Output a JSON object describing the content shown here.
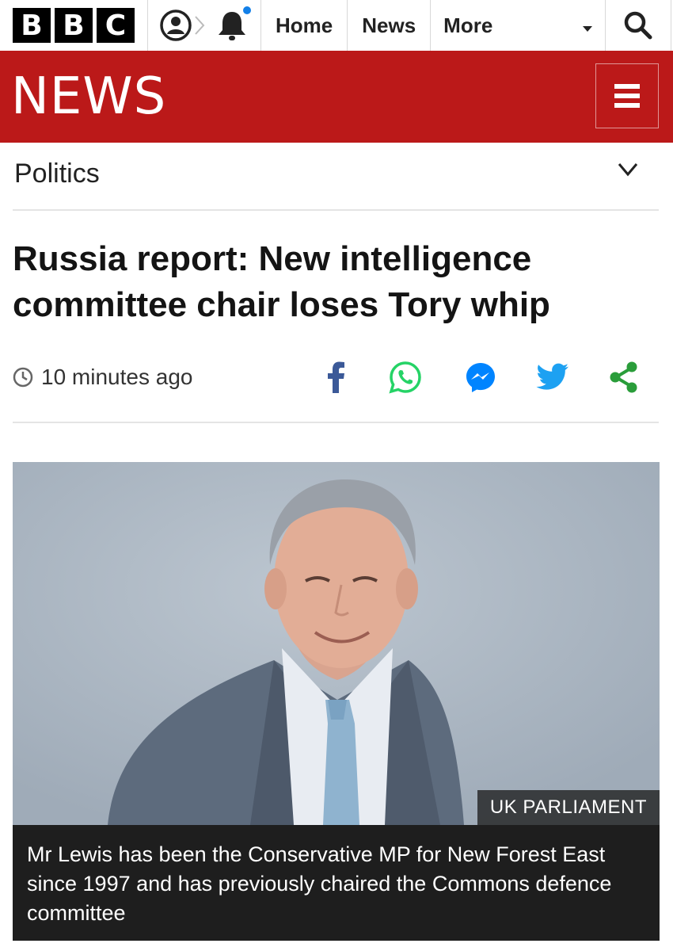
{
  "header": {
    "logo_letters": [
      "B",
      "B",
      "C"
    ],
    "nav": {
      "home": "Home",
      "news": "News",
      "more": "More"
    },
    "icons": {
      "account": "account-icon",
      "notifications": "bell-icon",
      "search": "search-icon"
    }
  },
  "banner": {
    "wordmark": "NEWS",
    "menu_icon": "hamburger-menu-icon"
  },
  "section": {
    "title": "Politics",
    "toggle_icon": "chevron-down-icon"
  },
  "article": {
    "headline": "Russia report: New intelligence committee chair loses Tory whip",
    "timestamp": "10 minutes ago",
    "share_icons": [
      "facebook-icon",
      "whatsapp-icon",
      "messenger-icon",
      "twitter-icon",
      "share-icon"
    ]
  },
  "image": {
    "credit": "UK PARLIAMENT",
    "caption": "Mr Lewis has been the Conservative MP for New Forest East since 1997 and has previously chaired the Commons defence committee"
  },
  "colors": {
    "brand_red": "#bb1919",
    "facebook": "#3b5998",
    "whatsapp": "#25d366",
    "messenger": "#0084ff",
    "twitter": "#1da1f2",
    "share": "#2a9d3a",
    "notification_dot": "#1380e8"
  }
}
